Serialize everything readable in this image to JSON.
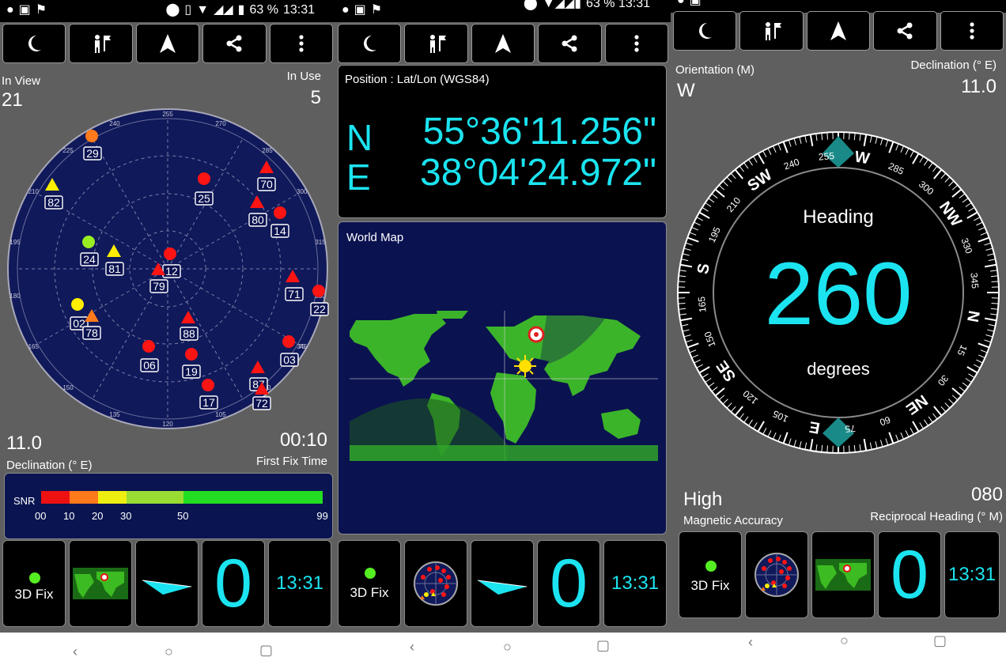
{
  "status_bar": {
    "battery": "63 %",
    "time": "13:31",
    "time_partial": "63 % 13:31"
  },
  "panel_satellites": {
    "in_view_label": "In View",
    "in_view_value": "21",
    "in_use_label": "In Use",
    "in_use_value": "5",
    "declination_value": "11.0",
    "declination_label": "Declination (° E)",
    "first_fix_value": "00:10",
    "first_fix_label": "First Fix Time",
    "azimuth_ticks": [
      "240",
      "255",
      "270",
      "285",
      "300",
      "315",
      "330",
      "345",
      "225",
      "210",
      "195",
      "180",
      "165",
      "150",
      "135",
      "120",
      "105",
      "90",
      "75"
    ],
    "satellites": [
      {
        "id": "29",
        "shape": "circle",
        "color": "#ff7a1a"
      },
      {
        "id": "82",
        "shape": "triangle",
        "color": "#ffee00"
      },
      {
        "id": "25",
        "shape": "circle",
        "color": "#ff1414"
      },
      {
        "id": "70",
        "shape": "triangle",
        "color": "#ff1414"
      },
      {
        "id": "80",
        "shape": "triangle",
        "color": "#ff1414"
      },
      {
        "id": "14",
        "shape": "circle",
        "color": "#ff1414"
      },
      {
        "id": "24",
        "shape": "circle",
        "color": "#99ee22"
      },
      {
        "id": "81",
        "shape": "triangle",
        "color": "#ffee00"
      },
      {
        "id": "12",
        "shape": "circle",
        "color": "#ff1414"
      },
      {
        "id": "79",
        "shape": "triangle",
        "color": "#ff1414"
      },
      {
        "id": "71",
        "shape": "triangle",
        "color": "#ff1414"
      },
      {
        "id": "22",
        "shape": "circle",
        "color": "#ff1414"
      },
      {
        "id": "02",
        "shape": "circle",
        "color": "#ffee00"
      },
      {
        "id": "78",
        "shape": "triangle",
        "color": "#ff7a1a"
      },
      {
        "id": "88",
        "shape": "triangle",
        "color": "#ff1414"
      },
      {
        "id": "06",
        "shape": "circle",
        "color": "#ff1414"
      },
      {
        "id": "19",
        "shape": "circle",
        "color": "#ff1414"
      },
      {
        "id": "03",
        "shape": "circle",
        "color": "#ff1414"
      },
      {
        "id": "87",
        "shape": "triangle",
        "color": "#ff1414"
      },
      {
        "id": "17",
        "shape": "circle",
        "color": "#ff1414"
      },
      {
        "id": "72",
        "shape": "triangle",
        "color": "#ff1414"
      }
    ],
    "snr": {
      "label": "SNR",
      "ticks": [
        "00",
        "10",
        "20",
        "30",
        "50",
        "99"
      ]
    }
  },
  "panel_position": {
    "title": "Position : Lat/Lon (WGS84)",
    "lat_hemi": "N",
    "lat_value": "55°36'11.256\"",
    "lon_hemi": "E",
    "lon_value": "38°04'24.972\"",
    "map_title": "World Map"
  },
  "panel_compass": {
    "orientation_label": "Orientation (M)",
    "orientation_value": "W",
    "declination_label": "Declination (° E)",
    "declination_value": "11.0",
    "heading_label": "Heading",
    "heading_value": "260",
    "heading_unit": "degrees",
    "accuracy_value": "High",
    "accuracy_label": "Magnetic Accuracy",
    "reciprocal_value": "080",
    "reciprocal_label": "Reciprocal Heading (° M)",
    "dial_labels": [
      "W",
      "285",
      "300",
      "NW",
      "330",
      "345",
      "N",
      "15",
      "30",
      "NE",
      "60",
      "75",
      "E",
      "105",
      "120",
      "SE",
      "150",
      "165",
      "S",
      "195",
      "210",
      "SW",
      "240",
      "255"
    ]
  },
  "bottom_bar": {
    "fix_label": "3D Fix",
    "zero_value": "0",
    "time_value": "13:31"
  },
  "colors": {
    "cyan": "#1be4f0",
    "panel_bg": "#5f5f5f",
    "sky": "#111a55"
  }
}
